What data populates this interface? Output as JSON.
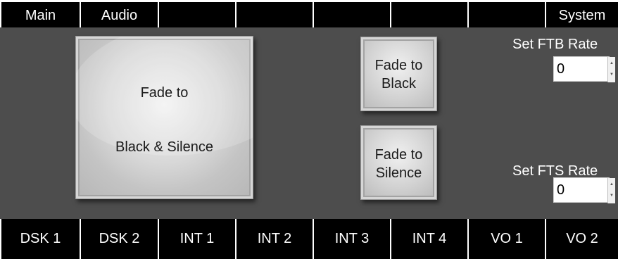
{
  "top_tabs": [
    {
      "label": "Main"
    },
    {
      "label": "Audio"
    },
    {
      "label": ""
    },
    {
      "label": ""
    },
    {
      "label": ""
    },
    {
      "label": ""
    },
    {
      "label": ""
    },
    {
      "label": "System"
    }
  ],
  "main": {
    "fade_black_silence": {
      "line1": "Fade to",
      "line2": "Black & Silence"
    },
    "fade_black": {
      "line1": "Fade to",
      "line2": "Black"
    },
    "fade_silence": {
      "line1": "Fade to",
      "line2": "Silence"
    },
    "ftb_rate": {
      "label": "Set FTB Rate",
      "value": "0"
    },
    "fts_rate": {
      "label": "Set FTS Rate",
      "value": "0"
    }
  },
  "bottom_tabs": [
    {
      "label": "DSK 1"
    },
    {
      "label": "DSK 2"
    },
    {
      "label": "INT 1"
    },
    {
      "label": "INT 2"
    },
    {
      "label": "INT 3"
    },
    {
      "label": "INT 4"
    },
    {
      "label": "VO 1"
    },
    {
      "label": "VO 2"
    }
  ],
  "colors": {
    "bar_background": "#000000",
    "panel_background": "#4d4d4d",
    "text_light": "#ffffff"
  }
}
